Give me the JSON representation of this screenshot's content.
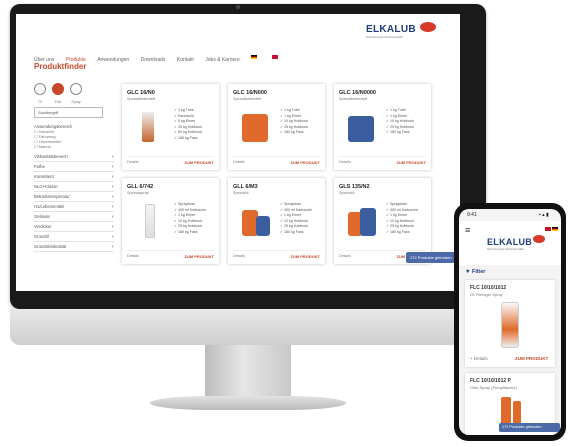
{
  "brand": {
    "name": "ELKALUB",
    "sub": "Schmierungs-Schmierstoffe"
  },
  "nav": {
    "items": [
      "Über uns",
      "Produkte",
      "Anwendungen",
      "Downloads",
      "Kontakt",
      "Jobs & Karriere"
    ],
    "active_index": 1
  },
  "page": {
    "title": "Produktfinder"
  },
  "sidebar": {
    "icons": [
      "Öl",
      "Fett",
      "Spray"
    ],
    "search": {
      "value": "Suchbegriff"
    },
    "group_title": "Anwendungsbereich",
    "checkboxes": [
      "Industrie",
      "Fahrzeug",
      "Lebensmittel",
      "Marine"
    ],
    "facets": [
      "Viskositätsbereich",
      "Farbe",
      "Konsistenz",
      "NLGI-Klasse",
      "Betriebstemperatur",
      "H1/Lebensmittel",
      "Gebinde",
      "Verdicker",
      "Grundöl",
      "Grundölviskosität"
    ]
  },
  "products": [
    {
      "title": "GLC 16/N0",
      "subtitle": "Spezialkettenfett",
      "features": [
        "1 kg Tube",
        "Kartusche",
        "5 kg Eimer",
        "25 kg Hobbock",
        "50 kg Hobbock",
        "180 kg Fass"
      ],
      "details": "Details",
      "cta": "ZUM PRODUKT",
      "color": "#e06a2b"
    },
    {
      "title": "GLC 16/N000",
      "subtitle": "Spezialkettenfett",
      "features": [
        "1 kg Tube",
        "1 kg Eimer",
        "10 kg Hobbock",
        "25 kg Hobbock",
        "180 kg Fass"
      ],
      "details": "Details",
      "cta": "ZUM PRODUKT",
      "color": "#e06a2b"
    },
    {
      "title": "GLC 16/N0000",
      "subtitle": "Spezialkettenfett",
      "features": [
        "1 kg Tube",
        "1 kg Eimer",
        "10 kg Hobbock",
        "25 kg Hobbock",
        "180 kg Fass"
      ],
      "details": "Details",
      "cta": "ZUM PRODUKT",
      "color": "#3a5ea0"
    },
    {
      "title": "GLL 6/742",
      "subtitle": "Spezialspray",
      "features": [
        "Spraydose",
        "400 ml Kartusche",
        "1 kg Eimer",
        "10 kg Hobbock",
        "25 kg Hobbock",
        "180 kg Fass"
      ],
      "details": "Details",
      "cta": "ZUM PRODUKT",
      "color": "#e06a2b"
    },
    {
      "title": "GLL 6/M3",
      "subtitle": "Spezialöl",
      "features": [
        "Spraydose",
        "400 ml Kartusche",
        "1 kg Eimer",
        "10 kg Hobbock",
        "25 kg Hobbock",
        "180 kg Fass"
      ],
      "details": "Details",
      "cta": "ZUM PRODUKT",
      "color": "#e06a2b"
    },
    {
      "title": "GLS 135/N2",
      "subtitle": "Spezialöl",
      "features": [
        "Spraydose",
        "400 ml Kartusche",
        "1 kg Eimer",
        "10 kg Hobbock",
        "25 kg Hobbock",
        "180 kg Fass"
      ],
      "details": "Details",
      "cta": "ZUM PRODUKT",
      "color": "#3a5ea0"
    }
  ],
  "results_badge": "172 Produkte gefunden",
  "mobile": {
    "time": "9:41",
    "filter_label": "Filter",
    "cards": [
      {
        "title": "FLC 10/10/1012",
        "subtitle": "Öl, Reiniger Spray",
        "details": "Details",
        "cta": "ZUM PRODUKT"
      },
      {
        "title": "FLC 10/10/1012 P",
        "subtitle": "Gleit-Spray (Pumpflasche)"
      }
    ],
    "badge": "172 Produkte gefunden"
  }
}
